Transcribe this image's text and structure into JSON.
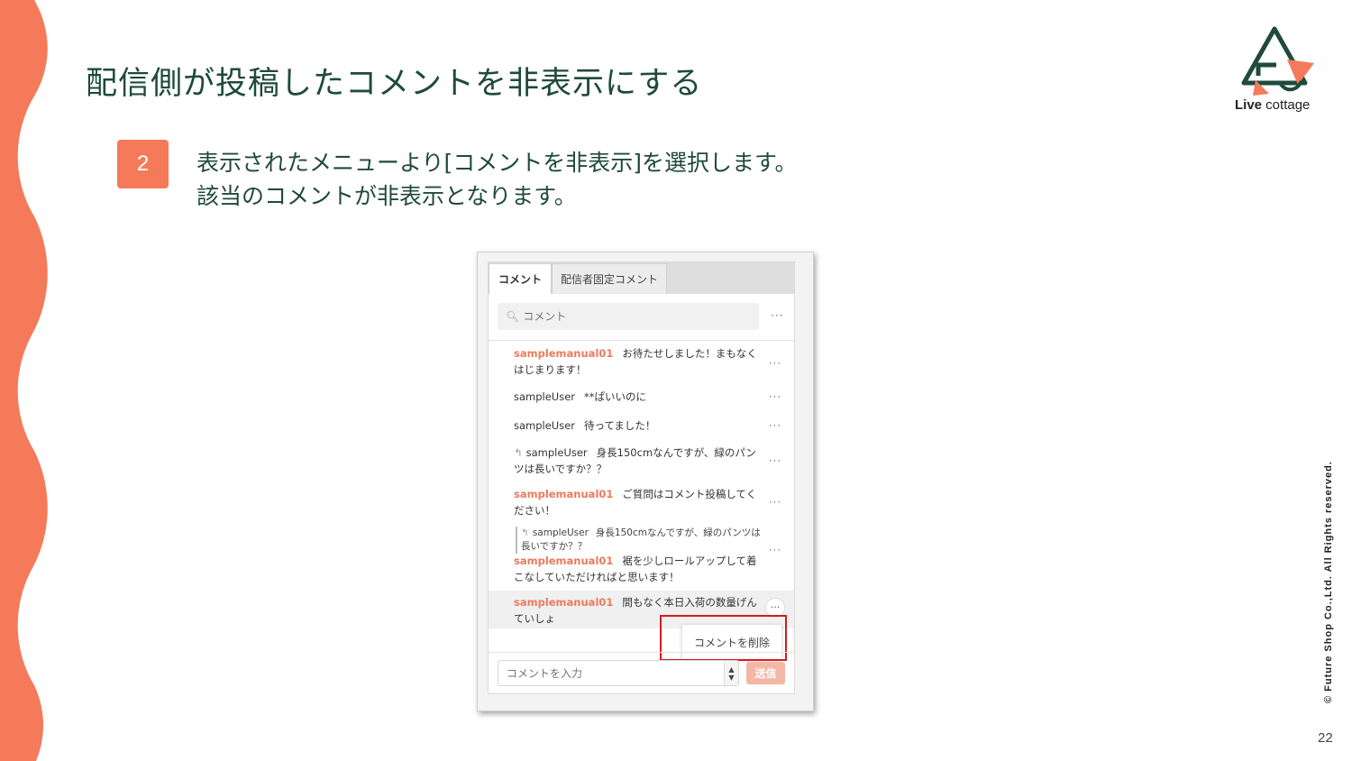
{
  "page": {
    "title": "配信側が投稿したコメントを非表示にする",
    "step_number": "2",
    "instructions": [
      "表示されたメニューより[コメントを非表示]を選択します。",
      "該当のコメントが非表示となります。"
    ],
    "logo": {
      "bold": "Live",
      "light": " cottage"
    },
    "copyright": "© Future Shop Co.,Ltd. All Rights reserved.",
    "page_number": "22"
  },
  "colors": {
    "accent": "#f47a5a",
    "title": "#1f4a3c",
    "highlight_box": "#d41c1c"
  },
  "panel": {
    "tabs": [
      "コメント",
      "配信者固定コメント"
    ],
    "search_placeholder": "コメント",
    "more": "···",
    "comments": [
      {
        "user": "samplemanual01",
        "text": "お待たせしました！まもなくはじまります！",
        "owner": true
      },
      {
        "user": "sampleUser",
        "text": "**ぱいいのに",
        "owner": false
      },
      {
        "user": "sampleUser",
        "text": "待ってました！",
        "owner": false
      },
      {
        "user": "sampleUser",
        "text": "身長150cmなんですが、緑のパンツは長いですか？？",
        "owner": false,
        "reply": true
      },
      {
        "user": "samplemanual01",
        "text": "ご質問はコメント投稿してください！",
        "owner": true
      },
      {
        "quote_user": "sampleUser",
        "quote_text": "身長150cmなんですが、緑のパンツは長いですか？？",
        "user": "samplemanual01",
        "text": "裾を少しロールアップして着こなしていただければと思います！",
        "owner": true
      },
      {
        "user": "samplemanual01",
        "text": "間もなく本日入荷の数量げんていしょ",
        "owner": true,
        "highlighted": true
      }
    ],
    "context_menu_item": "コメントを削除",
    "input_placeholder": "コメントを入力",
    "send_label": "送信"
  }
}
